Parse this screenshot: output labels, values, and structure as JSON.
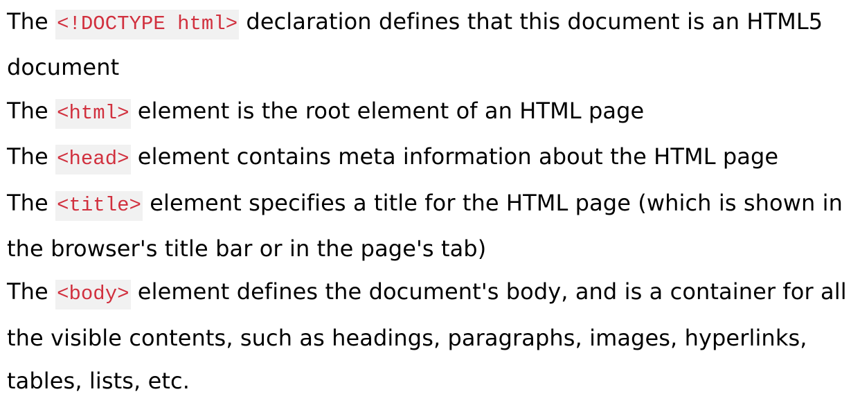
{
  "lines": [
    {
      "before": "The ",
      "code": "<!DOCTYPE html>",
      "after": " declaration defines that this document is an HTML5 document"
    },
    {
      "before": "The ",
      "code": "<html>",
      "after": " element is the root element of an HTML page"
    },
    {
      "before": "The ",
      "code": "<head>",
      "after": " element contains meta information about the HTML page"
    },
    {
      "before": "The ",
      "code": "<title>",
      "after": " element specifies a title for the HTML page (which is shown in the browser's title bar or in the page's tab)"
    },
    {
      "before": "The ",
      "code": "<body>",
      "after": " element defines the document's body, and is a container for all the visible contents, such as headings, paragraphs, images, hyperlinks, tables, lists, etc."
    }
  ],
  "colors": {
    "text": "#000000",
    "code_text": "#d1303e",
    "code_background": "#f1f1f1",
    "page_background": "#ffffff"
  }
}
